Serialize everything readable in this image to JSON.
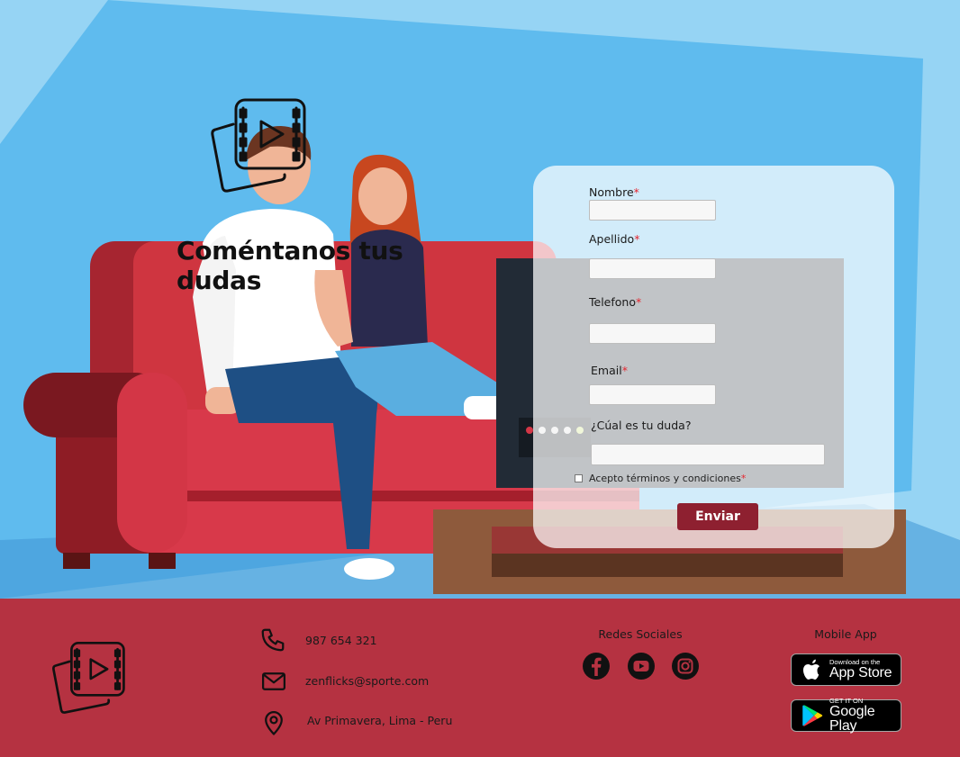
{
  "hero": {
    "heading": "Coméntanos tus dudas"
  },
  "form": {
    "fields": [
      {
        "label": "Nombre",
        "required": "*",
        "value": ""
      },
      {
        "label": "Apellido",
        "required": "*",
        "value": ""
      },
      {
        "label": "Telefono",
        "required": "*",
        "value": ""
      },
      {
        "label": "Email",
        "required": "*",
        "value": ""
      },
      {
        "label": "¿Cúal es tu duda?",
        "required": "",
        "value": ""
      }
    ],
    "terms_label": "Acepto términos y condiciones",
    "terms_required": "*",
    "submit_label": "Enviar"
  },
  "footer": {
    "logo_icon": "film-play-icon",
    "contact": {
      "phone": "987 654 321",
      "email": "zenflicks@sporte.com",
      "address": "Av Primavera, Lima - Peru"
    },
    "social_title": "Redes Sociales",
    "social_icons": [
      "facebook-icon",
      "youtube-icon",
      "instagram-icon"
    ],
    "app_title": "Mobile App",
    "app_store": {
      "small": "Download on the",
      "large": "App Store"
    },
    "google_play": {
      "small": "GET IT ON",
      "large": "Google Play"
    }
  },
  "colors": {
    "footer_bg": "#b53241",
    "button_bg": "#8e2030",
    "required": "#e5262f",
    "sky": "#96d4f4"
  }
}
